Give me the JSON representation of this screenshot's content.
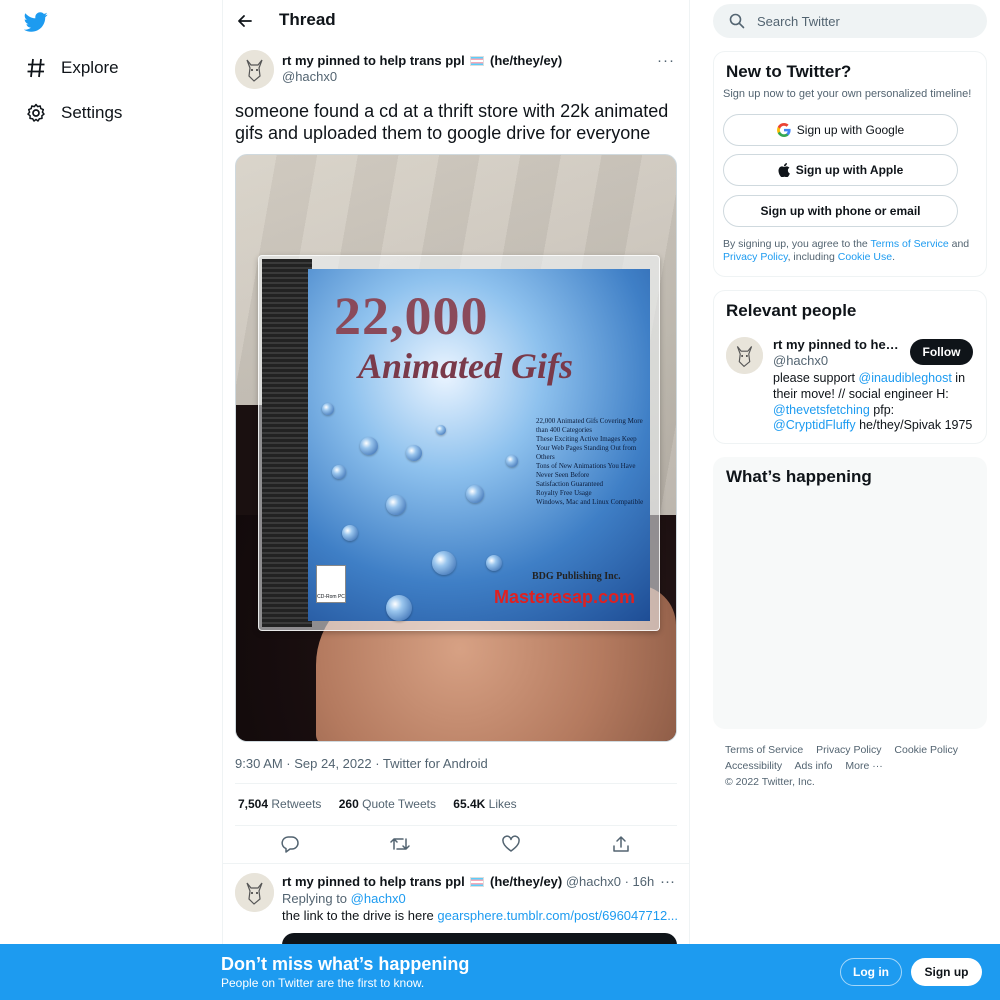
{
  "nav": {
    "explore_label": "Explore",
    "settings_label": "Settings",
    "logo_icon": "twitter-bird-icon",
    "brand_color": "#1d9bf0"
  },
  "thread": {
    "title": "Thread"
  },
  "tweet": {
    "author_name": "rt my pinned to help trans ppl",
    "author_pronouns": "(he/they/ey)",
    "author_handle": "@hachx0",
    "text": "someone found a cd at a thrift store with 22k animated gifs and uploaded them to google drive for everyone",
    "media": {
      "cover_title_1": "22,000",
      "cover_title_2": "Animated Gifs",
      "bullets": [
        "22,000 Animated Gifs Covering More than 400 Categories",
        "These Exciting Active Images Keep Your Web Pages Standing Out from Others",
        "Tons of New Animations You Have Never Seen Before",
        "Satisfaction Guaranteed",
        "Royalty Free Usage",
        "Windows, Mac and Linux Compatible"
      ],
      "publisher": "BDG Publishing Inc.",
      "brand": "Masterasap.com",
      "badge": "CD-Rom PC"
    },
    "timestamp": "9:30 AM · Sep 24, 2022 · Twitter for Android",
    "stats": {
      "retweets_count": "7,504",
      "retweets_label": "Retweets",
      "quotes_count": "260",
      "quotes_label": "Quote Tweets",
      "likes_count": "65.4K",
      "likes_label": "Likes"
    }
  },
  "reply": {
    "author_name": "rt my pinned to help trans ppl",
    "author_pronouns": "(he/they/ey)",
    "author_handle": "@hachx0",
    "time": "· 16h",
    "replying_to_label": "Replying to",
    "replying_to_handle": "@hachx0",
    "text": "the link to the drive is here",
    "link": "gearsphere.tumblr.com/post/696047712..."
  },
  "search": {
    "placeholder": "Search Twitter"
  },
  "new_to_twitter": {
    "title": "New to Twitter?",
    "subtitle": "Sign up now to get your own personalized timeline!",
    "google_label": "Sign up with Google",
    "apple_label": "Sign up with Apple",
    "phone_label": "Sign up with phone or email",
    "terms_prefix": "By signing up, you agree to the",
    "terms_link": "Terms of Service",
    "terms_and": "and",
    "privacy_link": "Privacy Policy",
    "terms_including": ", including",
    "cookie_link": "Cookie Use",
    "terms_end": "."
  },
  "relevant_people": {
    "title": "Relevant people",
    "name": "rt my pinned to help trans ppl",
    "handle": "@hachx0",
    "follow_label": "Follow",
    "bio_1": "please support",
    "bio_link_1": "@inaudibleghost",
    "bio_2": "in their move! // social engineer H:",
    "bio_link_2": "@thevetsfetching",
    "bio_3": "pfp:",
    "bio_link_3": "@CryptidFluffy",
    "bio_4": "he/they/Spivak 1975"
  },
  "whats_happening": {
    "title": "What’s happening"
  },
  "footer": {
    "terms": "Terms of Service",
    "privacy": "Privacy Policy",
    "cookie": "Cookie Policy",
    "accessibility": "Accessibility",
    "ads": "Ads info",
    "more": "More ···",
    "copyright": "© 2022 Twitter, Inc."
  },
  "bottom_bar": {
    "title": "Don’t miss what’s happening",
    "subtitle": "People on Twitter are the first to know.",
    "login_label": "Log in",
    "signup_label": "Sign up"
  }
}
